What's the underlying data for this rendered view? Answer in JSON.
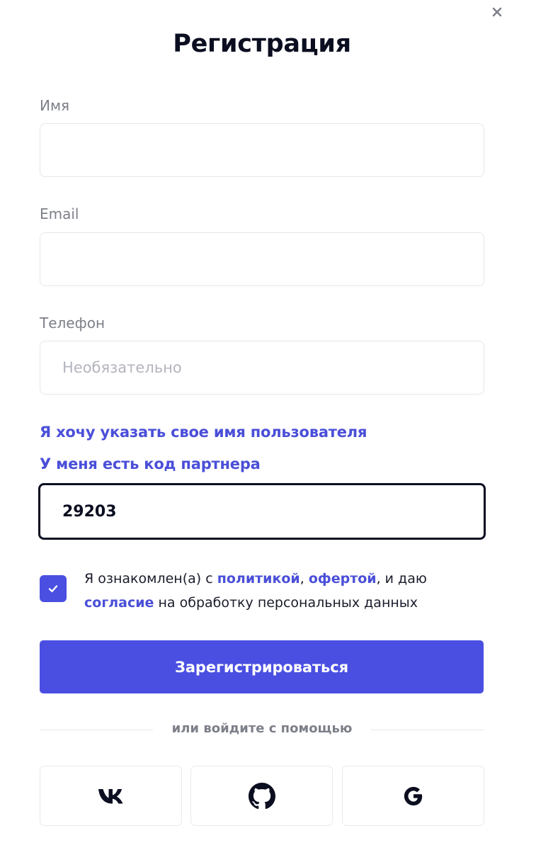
{
  "dialog": {
    "title": "Регистрация",
    "close_icon": "close-icon"
  },
  "form": {
    "name": {
      "label": "Имя",
      "value": "",
      "placeholder": ""
    },
    "email": {
      "label": "Email",
      "value": "",
      "placeholder": ""
    },
    "phone": {
      "label": "Телефон",
      "value": "",
      "placeholder": "Необязательно"
    },
    "username_link": "Я хочу указать свое имя пользователя",
    "partner_link": "У меня есть код партнера",
    "partner_code": {
      "value": "29203",
      "placeholder": ""
    }
  },
  "consent": {
    "checked": true,
    "text_1": "Я ознакомлен(а) с ",
    "policy_link": "политикой",
    "text_2": ", ",
    "offer_link": "офертой",
    "text_3": ", и даю ",
    "agreement_link": "согласие",
    "text_4": " на обработку персональных данных"
  },
  "submit_label": "Зарегистрироваться",
  "divider_text": "или войдите с помощью",
  "social": [
    {
      "name": "vk",
      "icon": "vk-icon"
    },
    {
      "name": "github",
      "icon": "github-icon"
    },
    {
      "name": "google",
      "icon": "google-icon"
    }
  ],
  "colors": {
    "accent": "#4a4fe2",
    "link": "#4a4fd8",
    "text": "#0b0e20",
    "muted": "#7d7f89",
    "border": "#e6e7ec"
  }
}
